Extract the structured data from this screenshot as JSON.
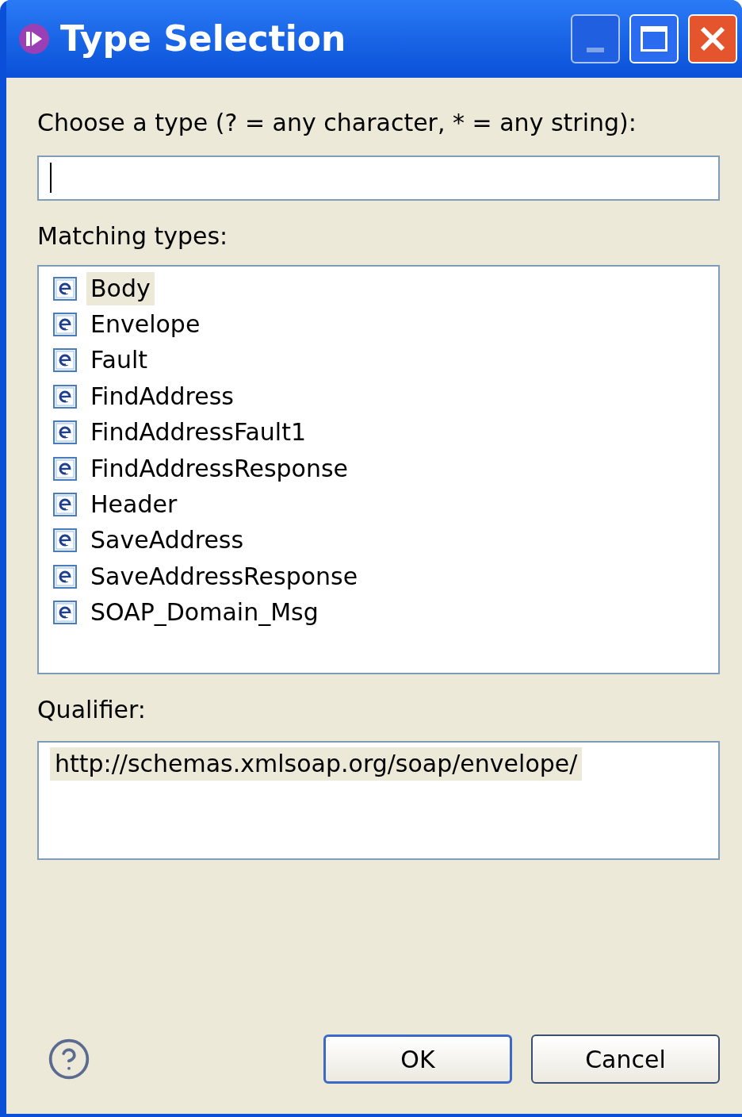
{
  "window": {
    "title": "Type Selection"
  },
  "filter": {
    "label": "Choose a type (? = any character, * = any string):"
  },
  "matching": {
    "label": "Matching types:",
    "items": [
      {
        "label": "Body",
        "selected": true
      },
      {
        "label": "Envelope",
        "selected": false
      },
      {
        "label": "Fault",
        "selected": false
      },
      {
        "label": "FindAddress",
        "selected": false
      },
      {
        "label": "FindAddressFault1",
        "selected": false
      },
      {
        "label": "FindAddressResponse",
        "selected": false
      },
      {
        "label": "Header",
        "selected": false
      },
      {
        "label": "SaveAddress",
        "selected": false
      },
      {
        "label": "SaveAddressResponse",
        "selected": false
      },
      {
        "label": "SOAP_Domain_Msg",
        "selected": false
      }
    ]
  },
  "qualifier": {
    "label": "Qualifier:",
    "items": [
      {
        "label": "http://schemas.xmlsoap.org/soap/envelope/",
        "selected": true
      }
    ]
  },
  "buttons": [
    {
      "label": "OK",
      "default": true
    },
    {
      "label": "Cancel",
      "default": false
    }
  ]
}
